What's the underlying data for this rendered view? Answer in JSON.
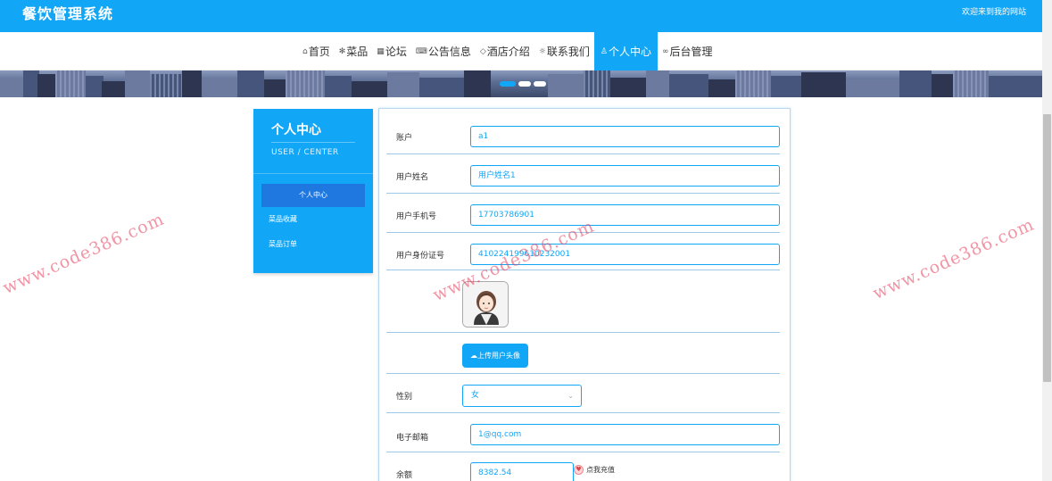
{
  "header": {
    "brand": "餐饮管理系统",
    "welcome": "欢迎来到我的网站"
  },
  "nav": {
    "items": [
      {
        "icon": "home-icon",
        "glyph": "⌂",
        "label": "首页"
      },
      {
        "icon": "dishes-icon",
        "glyph": "✻",
        "label": "菜品"
      },
      {
        "icon": "forum-icon",
        "glyph": "▦",
        "label": "论坛"
      },
      {
        "icon": "notice-icon",
        "glyph": "⌨",
        "label": "公告信息"
      },
      {
        "icon": "hotel-icon",
        "glyph": "◇",
        "label": "酒店介绍"
      },
      {
        "icon": "contact-icon",
        "glyph": "☼",
        "label": "联系我们"
      },
      {
        "icon": "user-icon",
        "glyph": "♙",
        "label": "个人中心"
      },
      {
        "icon": "admin-link-icon",
        "glyph": "∞",
        "label": "后台管理"
      }
    ],
    "active_index": 6
  },
  "sidebar": {
    "title": "个人中心",
    "subtitle": "USER / CENTER",
    "items": [
      {
        "label": "个人中心"
      },
      {
        "label": "菜品收藏"
      },
      {
        "label": "菜品订单"
      }
    ]
  },
  "form": {
    "account": {
      "label": "账户",
      "value": "a1"
    },
    "username": {
      "label": "用户姓名",
      "value": "用户姓名1"
    },
    "phone": {
      "label": "用户手机号",
      "value": "17703786901"
    },
    "id_card": {
      "label": "用户身份证号",
      "value": "410224199610232001"
    },
    "upload_button": "上传用户头像",
    "gender": {
      "label": "性别",
      "value": "女"
    },
    "email": {
      "label": "电子邮箱",
      "value": "1@qq.com"
    },
    "balance": {
      "label": "余额",
      "value": "8382.54"
    },
    "recharge_label": "点我充值"
  },
  "watermark": "www.code386.com",
  "colors": {
    "primary": "#12a6f6",
    "active_side": "#1f78e0",
    "watermark": "#e63c5a"
  }
}
